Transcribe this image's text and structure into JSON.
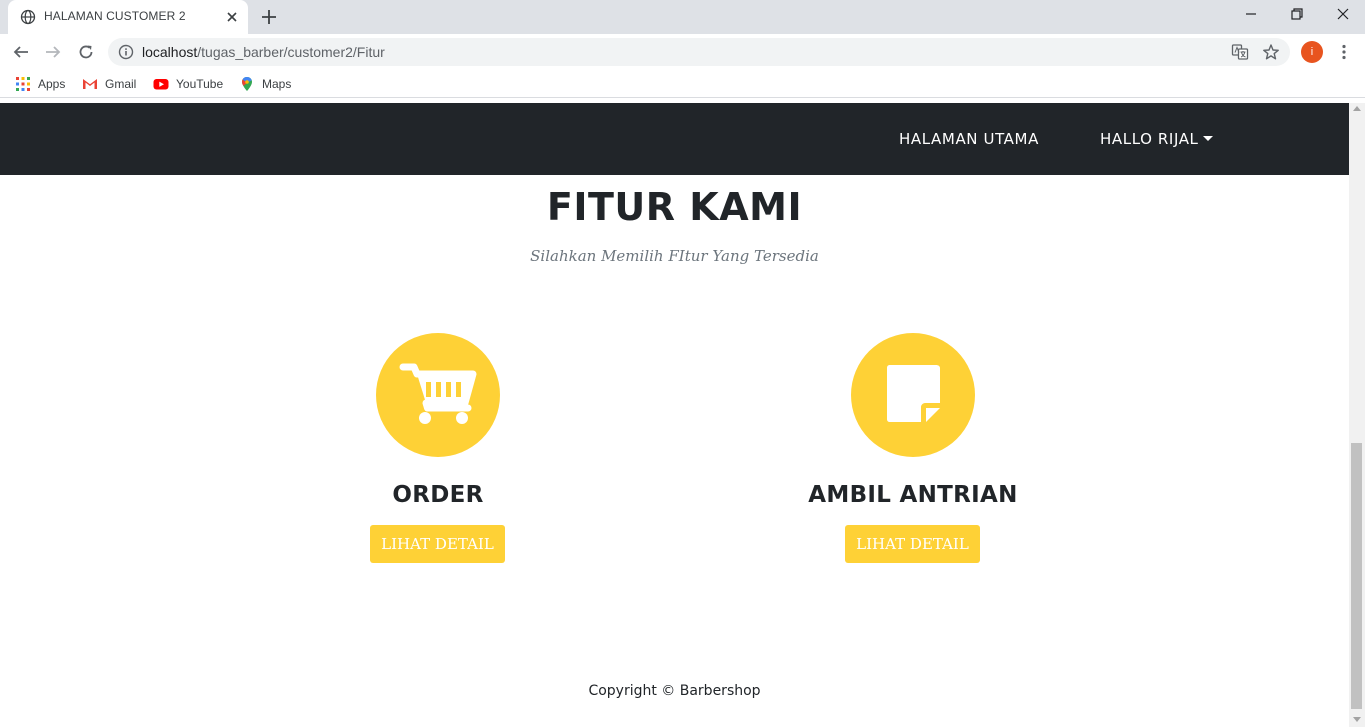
{
  "browser": {
    "tab_title": "HALAMAN CUSTOMER 2",
    "url_host": "localhost",
    "url_path": "/tugas_barber/customer2/Fitur",
    "profile_initial": "i",
    "bookmarks": [
      {
        "label": "Apps",
        "icon": "apps-grid-icon"
      },
      {
        "label": "Gmail",
        "icon": "gmail-icon"
      },
      {
        "label": "YouTube",
        "icon": "youtube-icon"
      },
      {
        "label": "Maps",
        "icon": "maps-pin-icon"
      }
    ]
  },
  "nav": {
    "home": "HALAMAN UTAMA",
    "user": "HALLO RIJAL"
  },
  "section": {
    "title": "FITUR KAMI",
    "subtitle": "Silahkan Memilih FItur Yang Tersedia"
  },
  "features": [
    {
      "name": "ORDER",
      "icon": "shopping-cart-icon",
      "button": "LIHAT DETAIL"
    },
    {
      "name": "AMBIL ANTRIAN",
      "icon": "sticky-note-icon",
      "button": "LIHAT DETAIL"
    }
  ],
  "footer": {
    "text": "Copyright © Barbershop"
  },
  "colors": {
    "accent": "#fed136",
    "navbar": "#212529",
    "text": "#212529"
  }
}
